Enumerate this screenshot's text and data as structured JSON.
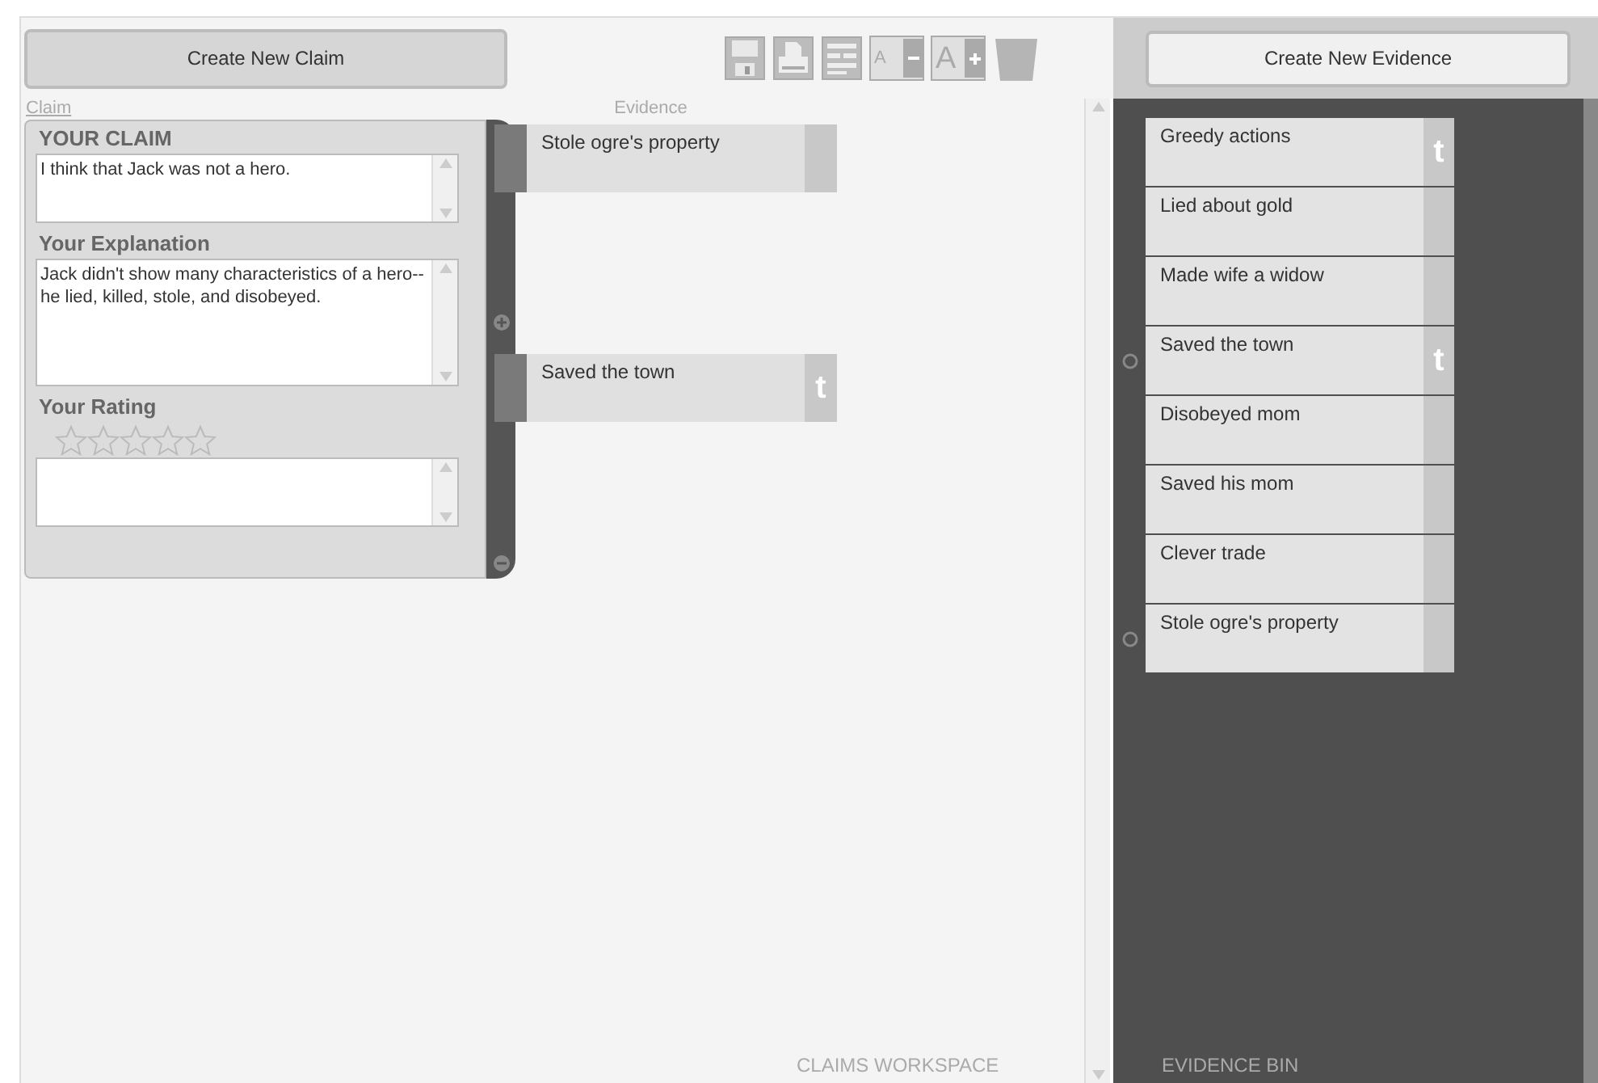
{
  "toolbar": {
    "create_claim_button": "Create New Claim",
    "tools": [
      {
        "kind": "save"
      },
      {
        "kind": "print"
      },
      {
        "kind": "layout"
      },
      {
        "kind": "font-smaller",
        "label": "A"
      },
      {
        "kind": "font-larger",
        "label": "A"
      },
      {
        "kind": "trash"
      }
    ]
  },
  "workspace": {
    "claim_label": "Claim",
    "evidence_label": "Evidence",
    "footer": "CLAIMS WORKSPACE",
    "claim_card": {
      "claim_heading": "YOUR CLAIM",
      "claim": "I think that Jack was not a hero.",
      "explanation_heading": "Your Explanation",
      "explanation": "Jack didn't show many characteristics of a hero--he lied, killed, stole, and disobeyed.",
      "rating_heading": "Your Rating",
      "stars": 0
    },
    "evidence": [
      {
        "text": "Stole ogre's property"
      },
      {
        "text": "Saved the town",
        "note": "t"
      }
    ]
  },
  "evidence_bin": {
    "create_evidence_button": "Create New Evidence",
    "footer": "EVIDENCE BIN",
    "items": [
      {
        "text": "Greedy actions",
        "note": "t",
        "linked": false
      },
      {
        "text": "Lied about gold",
        "linked": false
      },
      {
        "text": "Made wife a widow",
        "linked": false
      },
      {
        "text": "Saved the town",
        "note": "t",
        "linked": true
      },
      {
        "text": "Disobeyed mom",
        "linked": false
      },
      {
        "text": "Saved his mom",
        "linked": false
      },
      {
        "text": "Clever trade",
        "linked": false
      },
      {
        "text": "Stole ogre's property",
        "linked": true
      }
    ]
  }
}
